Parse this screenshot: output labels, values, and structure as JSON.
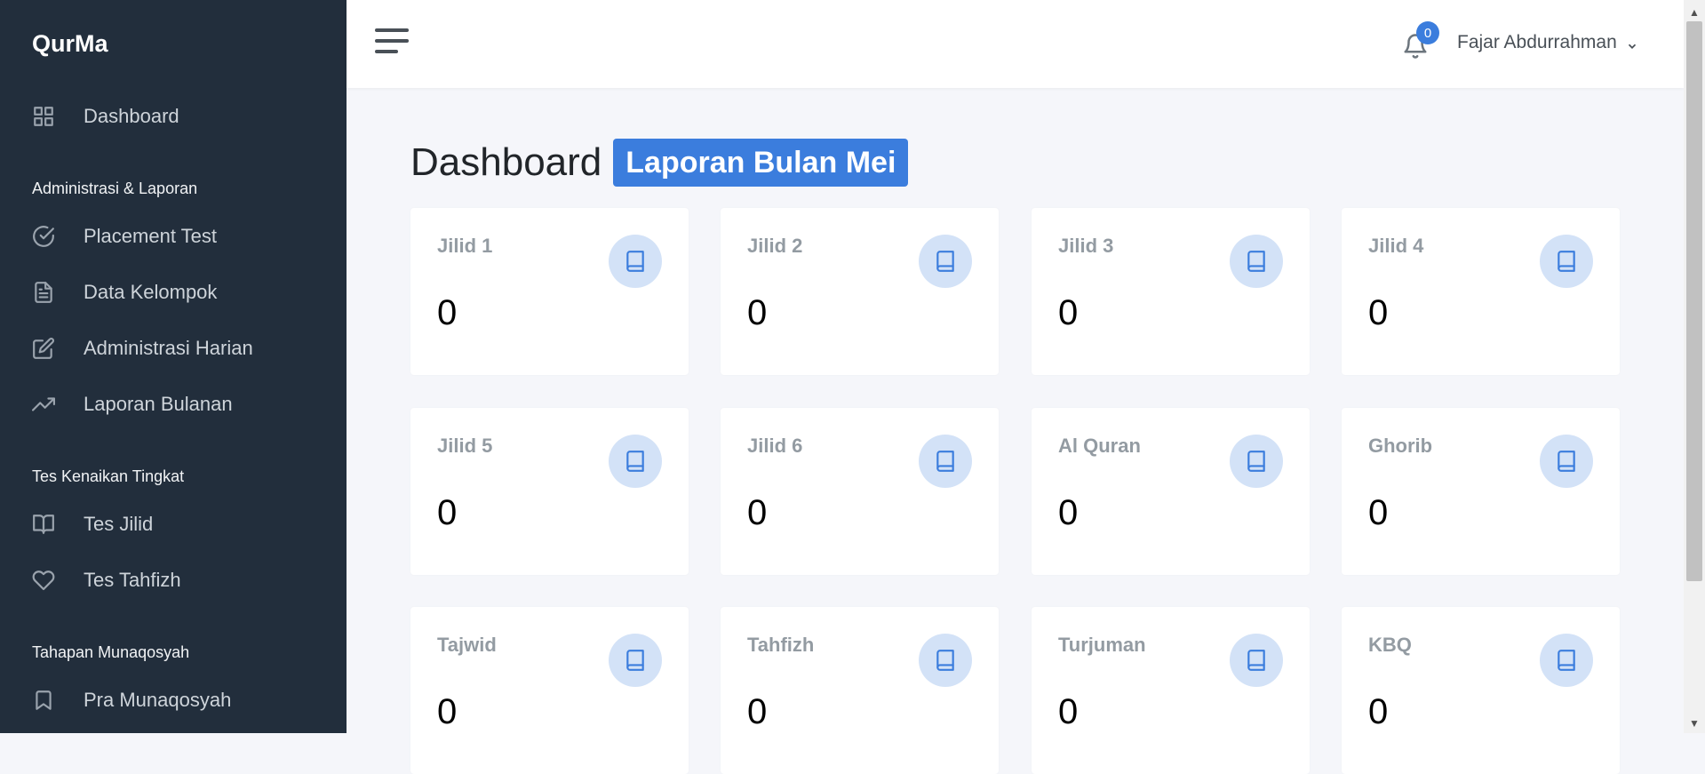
{
  "brand": "QurMa",
  "sidebar": {
    "items": [
      {
        "label": "Dashboard",
        "icon": "grid-icon"
      },
      {
        "label": "Placement Test",
        "icon": "check-circle-icon"
      },
      {
        "label": "Data Kelompok",
        "icon": "file-text-icon"
      },
      {
        "label": "Administrasi Harian",
        "icon": "edit-icon"
      },
      {
        "label": "Laporan Bulanan",
        "icon": "trending-up-icon"
      },
      {
        "label": "Tes Jilid",
        "icon": "book-open-icon"
      },
      {
        "label": "Tes Tahfizh",
        "icon": "heart-icon"
      },
      {
        "label": "Pra Munaqosyah",
        "icon": "bookmark-icon"
      }
    ],
    "headers": [
      "Administrasi & Laporan",
      "Tes Kenaikan Tingkat",
      "Tahapan Munaqosyah"
    ]
  },
  "topbar": {
    "notification_count": "0",
    "user_name": "Fajar Abdurrahman"
  },
  "main": {
    "title": "Dashboard",
    "badge": "Laporan Bulan Mei",
    "cards": [
      {
        "label": "Jilid 1",
        "value": "0"
      },
      {
        "label": "Jilid 2",
        "value": "0"
      },
      {
        "label": "Jilid 3",
        "value": "0"
      },
      {
        "label": "Jilid 4",
        "value": "0"
      },
      {
        "label": "Jilid 5",
        "value": "0"
      },
      {
        "label": "Jilid 6",
        "value": "0"
      },
      {
        "label": "Al Quran",
        "value": "0"
      },
      {
        "label": "Ghorib",
        "value": "0"
      },
      {
        "label": "Tajwid",
        "value": "0"
      },
      {
        "label": "Tahfizh",
        "value": "0"
      },
      {
        "label": "Turjuman",
        "value": "0"
      },
      {
        "label": "KBQ",
        "value": "0"
      }
    ]
  },
  "colors": {
    "sidebar_bg": "#222e3c",
    "accent": "#3b7ddd",
    "icon_circle_bg": "#d3e2f7"
  }
}
